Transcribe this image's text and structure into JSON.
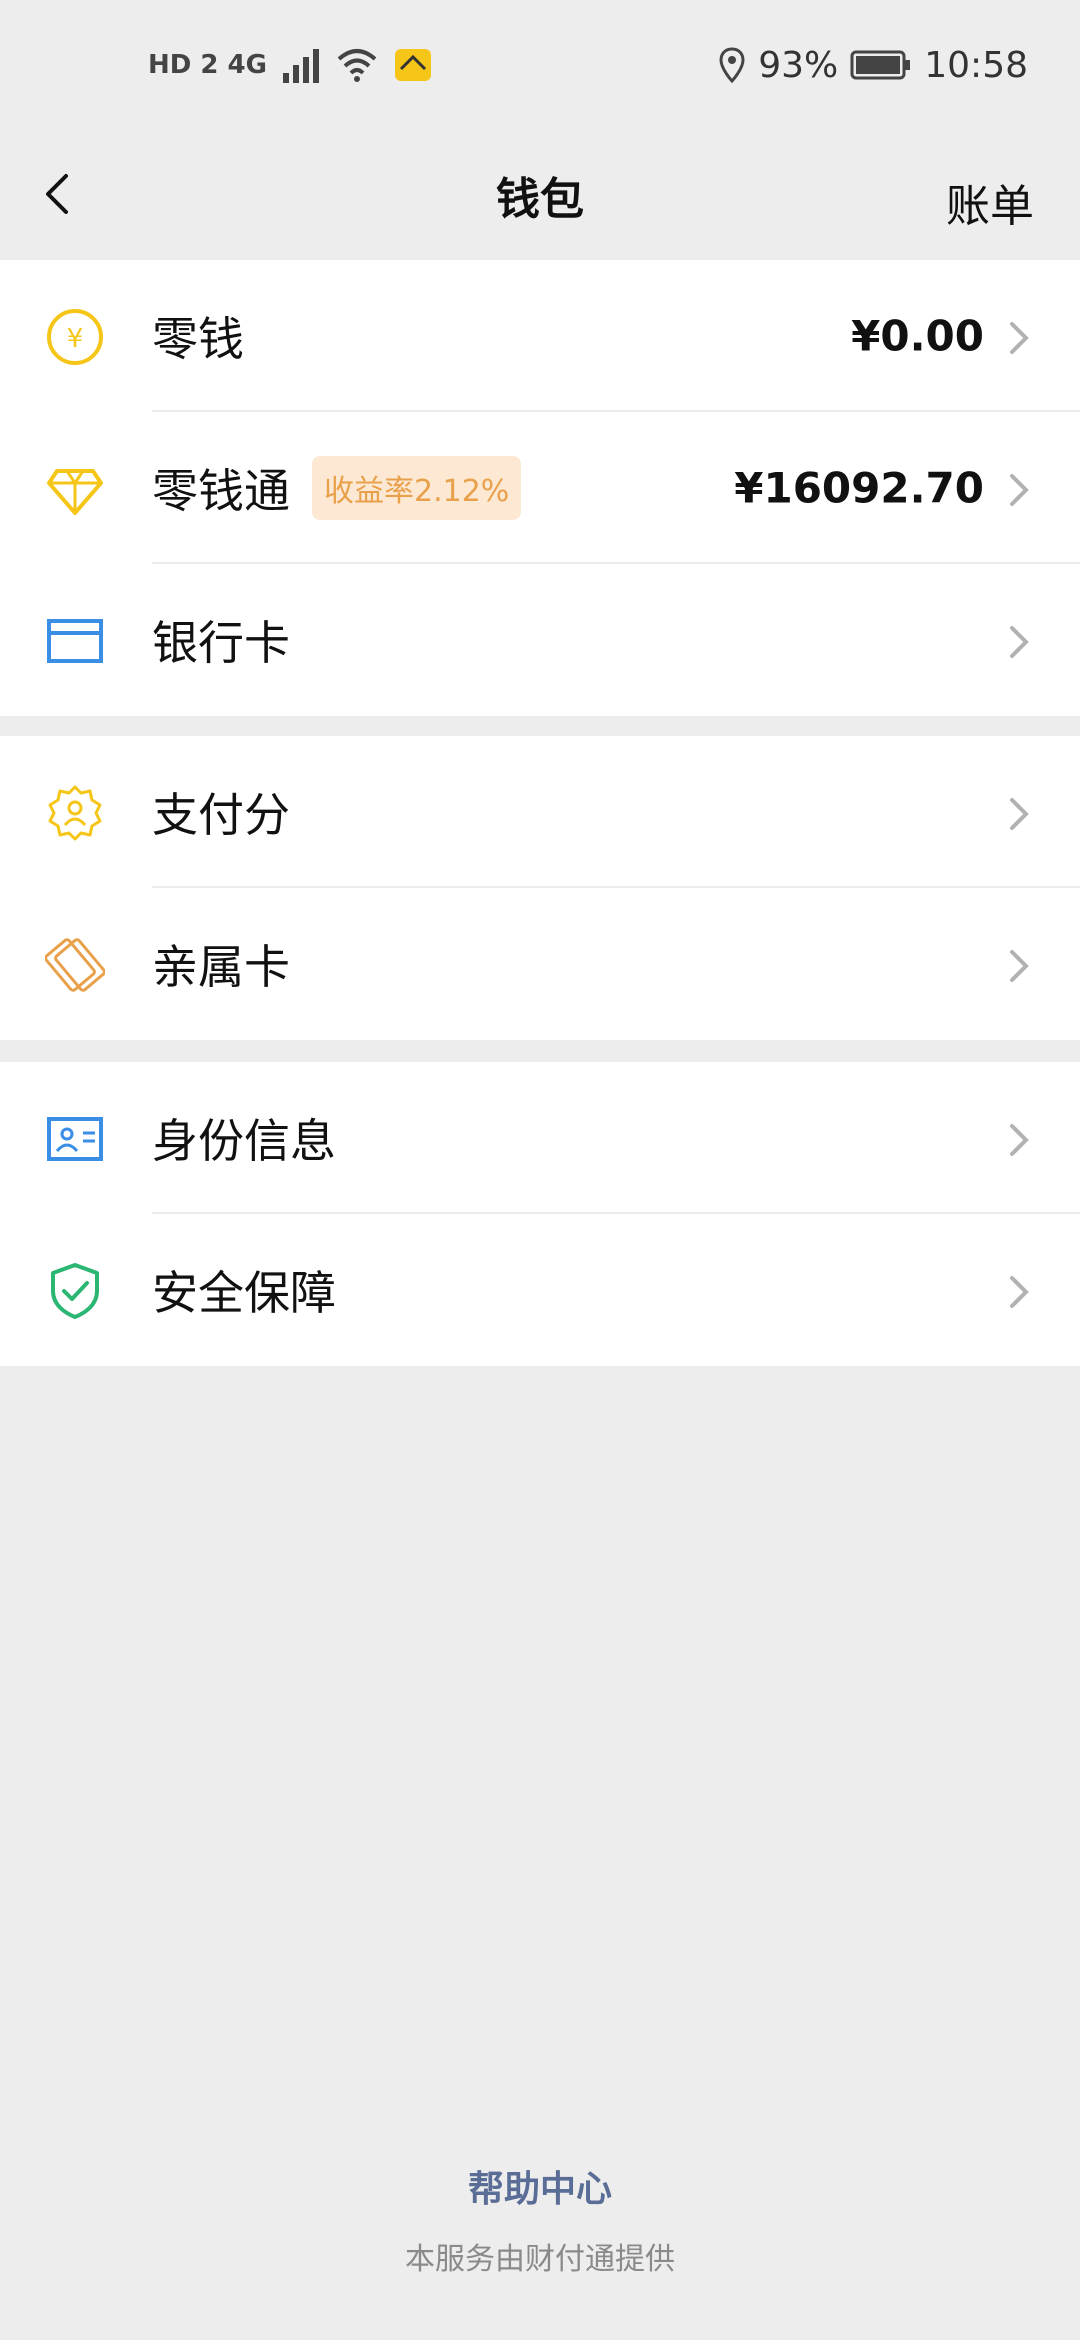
{
  "status_bar": {
    "network": "HD 2 4G",
    "battery": "93%",
    "time": "10:58"
  },
  "nav": {
    "title": "钱包",
    "right_label": "账单"
  },
  "groups": [
    {
      "items": [
        {
          "label": "零钱",
          "amount": "¥0.00",
          "icon": "yen-coin-icon"
        },
        {
          "label": "零钱通",
          "badge": "收益率2.12%",
          "amount": "¥16092.70",
          "icon": "diamond-icon"
        },
        {
          "label": "银行卡",
          "icon": "bank-card-icon"
        }
      ]
    },
    {
      "items": [
        {
          "label": "支付分",
          "icon": "pay-score-icon"
        },
        {
          "label": "亲属卡",
          "icon": "family-card-icon"
        }
      ]
    },
    {
      "items": [
        {
          "label": "身份信息",
          "icon": "id-card-icon"
        },
        {
          "label": "安全保障",
          "icon": "shield-check-icon"
        }
      ]
    }
  ],
  "footer": {
    "help": "帮助中心",
    "provider": "本服务由财付通提供"
  },
  "colors": {
    "background": "#ededed",
    "yellow": "#f5c518",
    "blue": "#3a8ee6",
    "orange": "#e9a04a",
    "green": "#2bb673",
    "help_link": "#5a6d96"
  }
}
